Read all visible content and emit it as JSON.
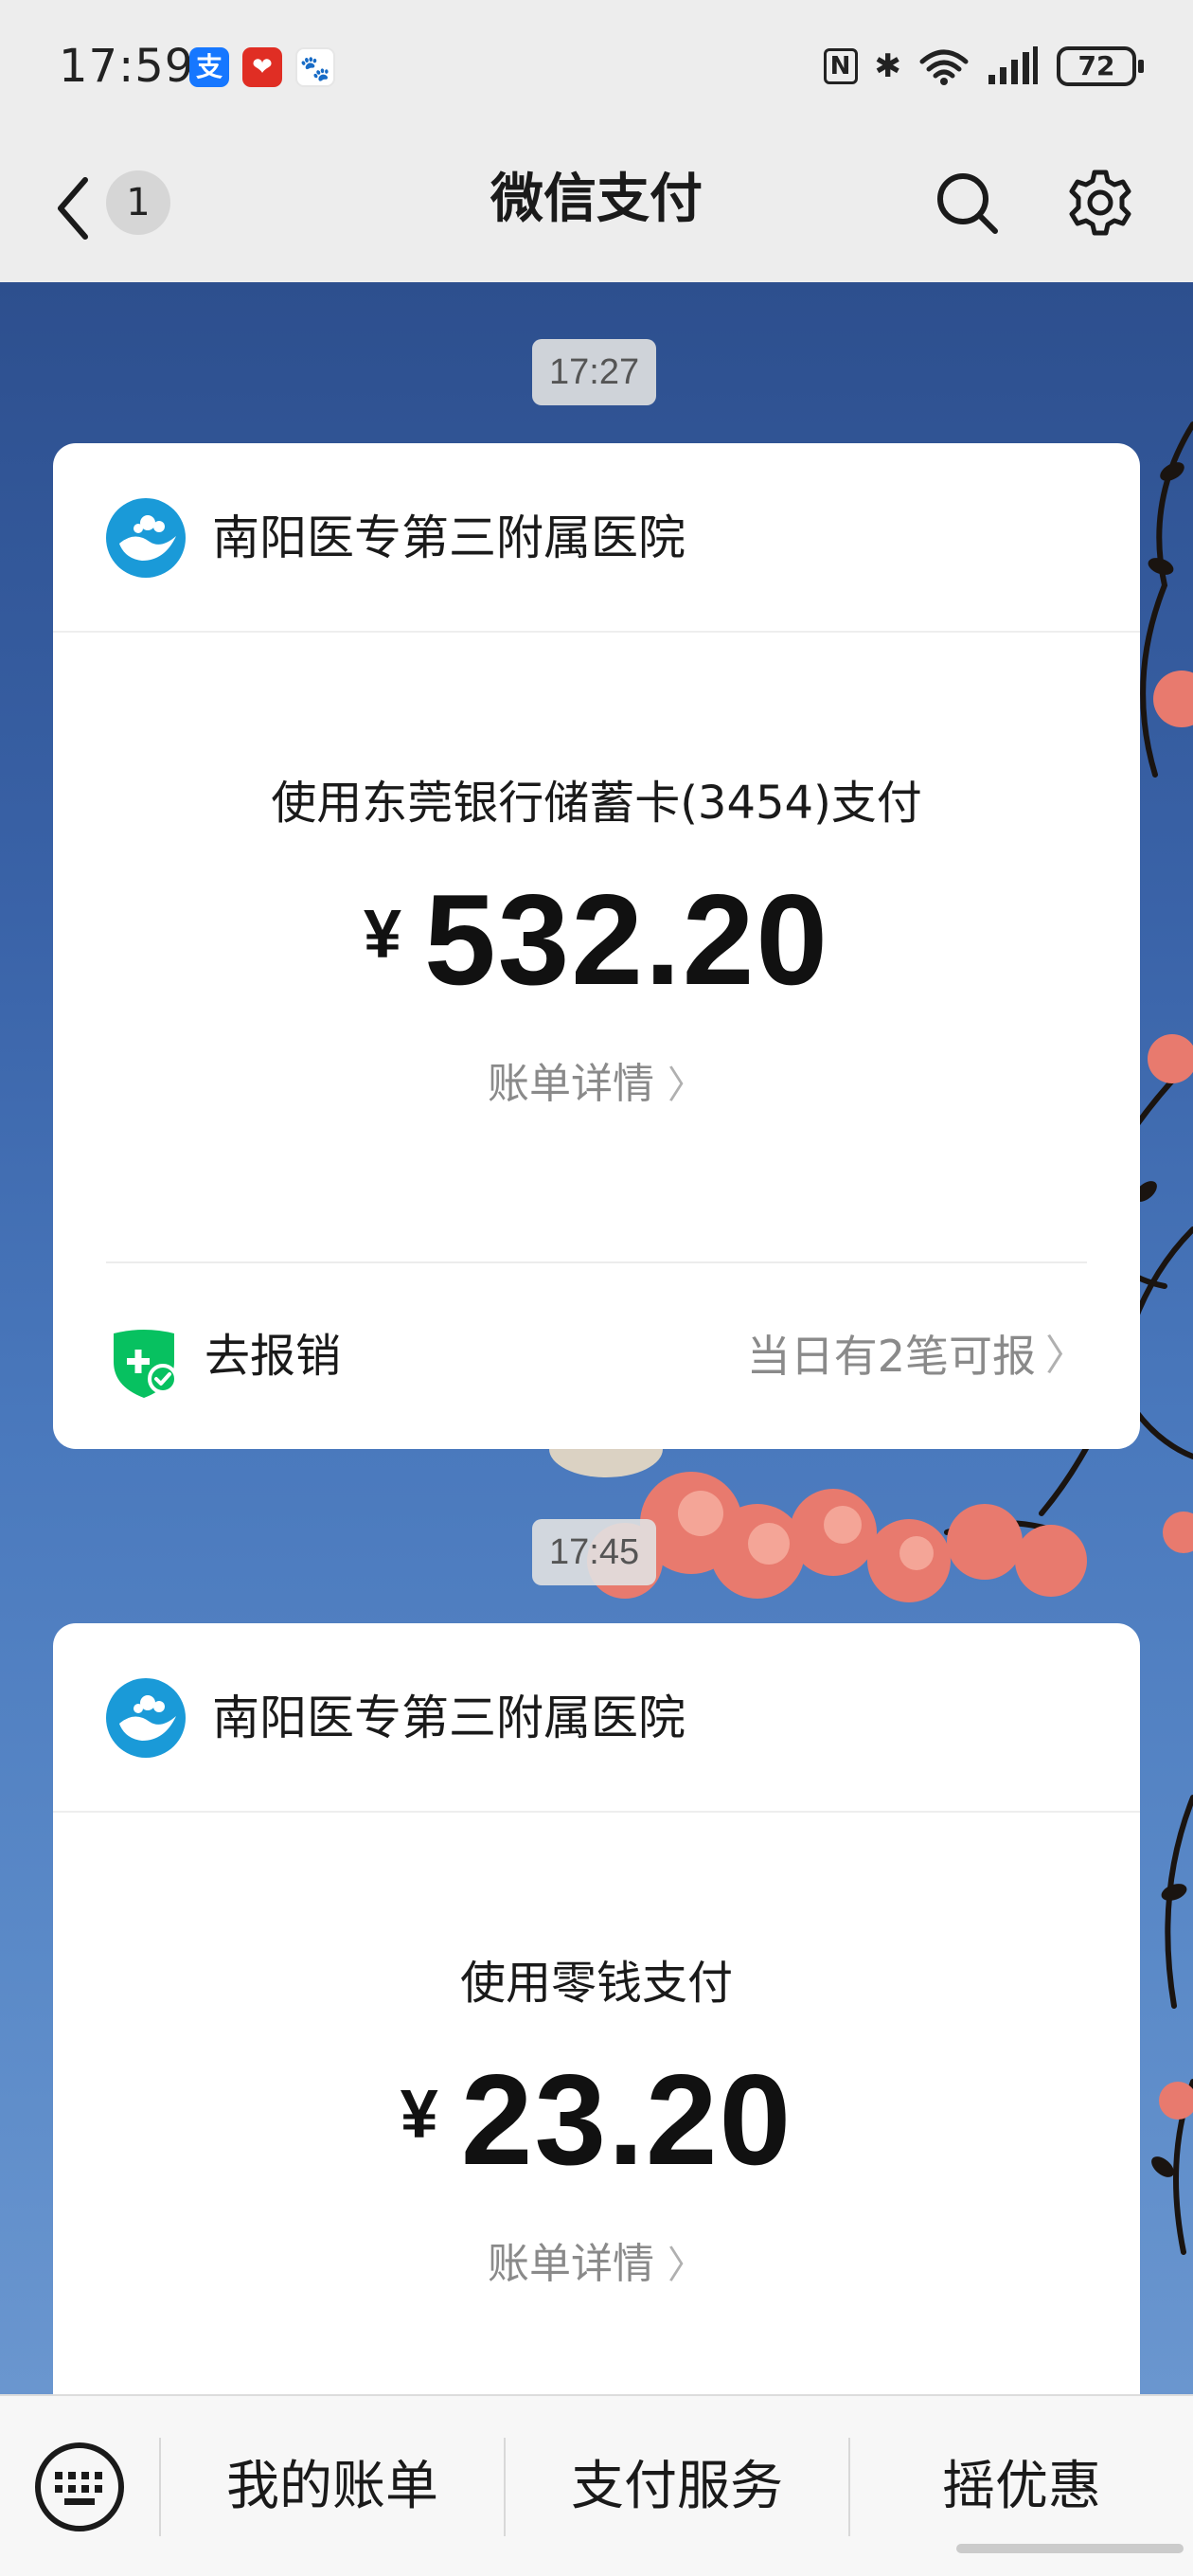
{
  "status_bar": {
    "time": "17:59",
    "app_icons": [
      {
        "name": "alipay-icon",
        "glyph": "支",
        "color": "#1677ff"
      },
      {
        "name": "pinduoduo-icon",
        "glyph": "❤",
        "color": "#e02e24"
      },
      {
        "name": "baidu-icon",
        "glyph": "🐾",
        "color": "#2f5dd6"
      }
    ],
    "nfc": "N",
    "bluetooth": "✱",
    "battery": "72"
  },
  "nav": {
    "title": "微信支付",
    "unread_count": "1"
  },
  "messages": [
    {
      "timestamp": "17:27",
      "merchant": "南阳医专第三附属医院",
      "pay_method": "使用东莞银行储蓄卡(3454)支付",
      "currency": "¥",
      "amount": "532.20",
      "bill_detail": "账单详情",
      "reimburse_label": "去报销",
      "reimburse_note": "当日有2笔可报"
    },
    {
      "timestamp": "17:45",
      "merchant": "南阳医专第三附属医院",
      "pay_method": "使用零钱支付",
      "currency": "¥",
      "amount": "23.20",
      "bill_detail": "账单详情"
    }
  ],
  "bottom_menu": {
    "items": [
      "我的账单",
      "支付服务",
      "摇优惠"
    ]
  },
  "colors": {
    "brand_green": "#07c160",
    "merchant_logo": "#1a9ad8"
  }
}
